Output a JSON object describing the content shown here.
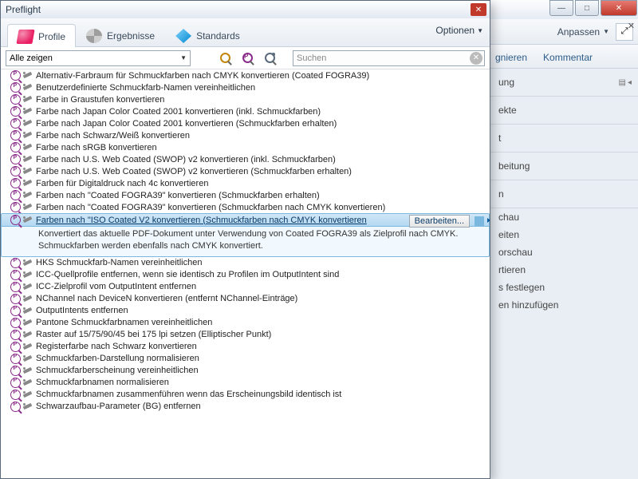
{
  "dialog": {
    "title": "Preflight",
    "tabs": {
      "profile": "Profile",
      "ergebnisse": "Ergebnisse",
      "standards": "Standards"
    },
    "optionen": "Optionen",
    "filter": {
      "combo": "Alle zeigen",
      "search_placeholder": "Suchen"
    }
  },
  "items": [
    "Alternativ-Farbraum für Schmuckfarben nach CMYK konvertieren (Coated FOGRA39)",
    "Benutzerdefinierte Schmuckfarb-Namen vereinheitlichen",
    "Farbe in Graustufen konvertieren",
    "Farbe nach Japan Color Coated 2001 konvertieren (inkl. Schmuckfarben)",
    "Farbe nach Japan Color Coated 2001 konvertieren (Schmuckfarben erhalten)",
    "Farbe nach Schwarz/Weiß konvertieren",
    "Farbe nach sRGB konvertieren",
    "Farbe nach U.S. Web Coated (SWOP) v2 konvertieren (inkl. Schmuckfarben)",
    "Farbe nach U.S. Web Coated (SWOP) v2 konvertieren (Schmuckfarben erhalten)",
    "Farben für Digitaldruck nach 4c konvertieren",
    "Farben nach \"Coated FOGRA39\" konvertieren (Schmuckfarben erhalten)",
    "Farben nach \"Coated FOGRA39\" konvertieren (Schmuckfarben nach CMYK konvertieren)"
  ],
  "selected": {
    "label": "Farben nach \"ISO Coated V2 konvertieren (Schmuckfarben nach CMYK konvertieren",
    "button": "Bearbeiten...",
    "desc": "Konvertiert das aktuelle PDF-Dokument unter Verwendung von Coated FOGRA39 als Zielprofil nach CMYK. Schmuckfarben werden ebenfalls nach CMYK konvertiert."
  },
  "items2": [
    "HKS Schmuckfarb-Namen vereinheitlichen",
    "ICC-Quellprofile entfernen, wenn sie identisch zu Profilen im OutputIntent sind",
    "ICC-Zielprofil vom OutputIntent entfernen",
    "NChannel nach DeviceN konvertieren (entfernt NChannel-Einträge)",
    "OutputIntents entfernen",
    "Pantone Schmuckfarbnamen vereinheitlichen",
    "Raster auf 15/75/90/45 bei 175 lpi setzen (Elliptischer Punkt)",
    "Registerfarbe nach Schwarz konvertieren",
    "Schmuckfarben-Darstellung normalisieren",
    "Schmuckfarberscheinung vereinheitlichen",
    "Schmuckfarbnamen normalisieren",
    "Schmuckfarbnamen zusammenführen wenn das Erscheinungsbild identisch ist",
    "Schwarzaufbau-Parameter (BG) entfernen"
  ],
  "bg": {
    "anpassen": "Anpassen",
    "tabs": {
      "sign": "gnieren",
      "komm": "Kommentar"
    },
    "panel_items": [
      "ung",
      "ekte",
      "t",
      "beitung",
      "n",
      "chau",
      "eiten",
      "orschau",
      "rtieren",
      "s festlegen",
      "en hinzufügen"
    ]
  }
}
